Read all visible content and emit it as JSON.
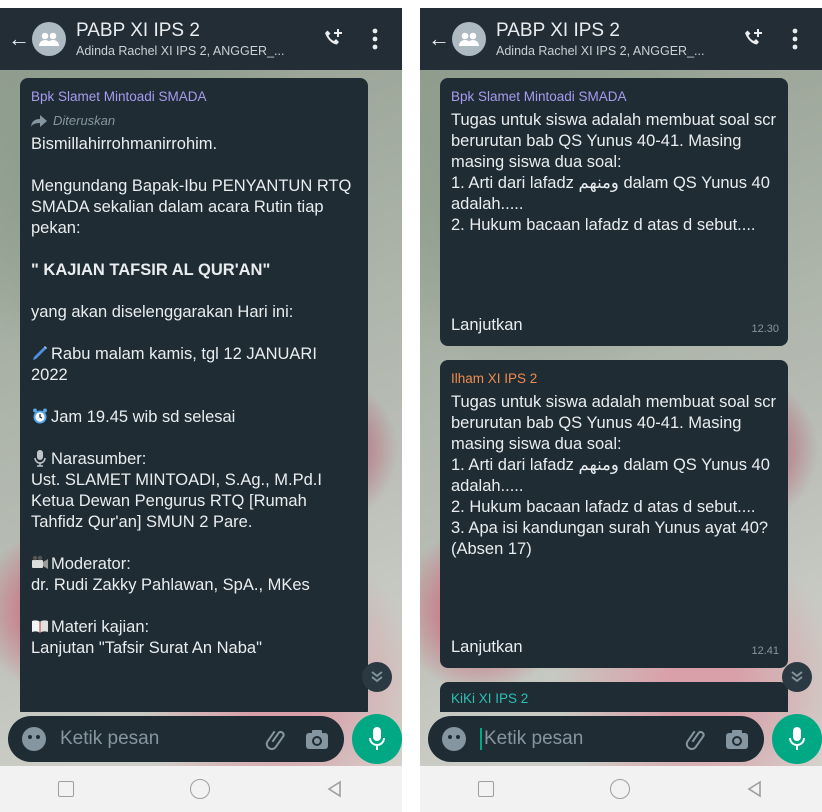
{
  "left": {
    "header": {
      "title": "PABP XI IPS 2",
      "subtitle": "Adinda Rachel XI IPS 2, ANGGER_..."
    },
    "message": {
      "sender": "Bpk Slamet Mintoadi SMADA",
      "forwarded": "Diteruskan",
      "lines": [
        "Bismillahirrohmanirrohim.",
        "",
        "Mengundang Bapak-Ibu PENYANTUN RTQ SMADA sekalian dalam acara Rutin tiap pekan:",
        "",
        "\" KAJIAN TAFSIR AL QUR'AN\"",
        "",
        "yang akan diselenggarakan Hari ini:",
        "",
        "Rabu malam kamis, tgl 12 JANUARI 2022",
        "",
        "Jam 19.45 wib sd selesai",
        "",
        "Narasumber:",
        "Ust. SLAMET MINTOADI, S.Ag., M.Pd.I",
        "Ketua Dewan Pengurus RTQ [Rumah Tahfidz Qur'an] SMUN 2 Pare.",
        "",
        "Moderator:",
        "dr. Rudi Zakky Pahlawan, SpA., MKes",
        "",
        "Materi kajian:",
        "Lanjutan \"Tafsir Surat An Naba\""
      ]
    },
    "input": {
      "placeholder": "Ketik pesan"
    }
  },
  "right": {
    "header": {
      "title": "PABP XI IPS 2",
      "subtitle": "Adinda Rachel XI IPS 2, ANGGER_..."
    },
    "messages": [
      {
        "sender": "Bpk Slamet Mintoadi SMADA",
        "sender_color": "#a79bf0",
        "text": "Tugas untuk siswa adalah membuat soal scr berurutan bab QS Yunus 40-41. Masing masing siswa dua soal:\n1. Arti dari lafadz ومنهم dalam QS Yunus 40 adalah.....\n2. Hukum bacaan lafadz d atas d sebut....",
        "more": "Lanjutkan",
        "time": "12.30"
      },
      {
        "sender": "Ilham XI IPS 2",
        "sender_color": "#f08a4b",
        "text": "Tugas untuk siswa adalah membuat soal scr berurutan bab QS Yunus 40-41. Masing masing siswa dua soal:\n1. Arti dari lafadz ومنهم dalam QS Yunus 40 adalah.....\n2. Hukum bacaan lafadz d atas d sebut....\n3. Apa isi kandungan surah Yunus ayat 40? (Absen 17)",
        "more": "Lanjutkan",
        "time": "12.41"
      },
      {
        "sender": "KiKi XI IPS 2",
        "sender_color": "#2bc0b4"
      }
    ],
    "input": {
      "placeholder": "Ketik pesan"
    }
  },
  "colors": {
    "header_bg": "#232d36",
    "bubble_bg": "#1f2c34",
    "accent": "#00a884",
    "left_sender": "#a79bf0"
  }
}
